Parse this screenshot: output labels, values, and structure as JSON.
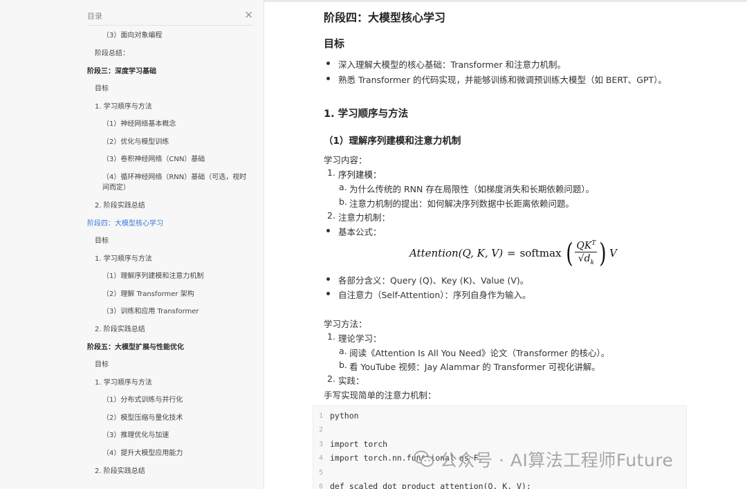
{
  "toc": {
    "title": "目录",
    "close_icon": "×",
    "items": [
      {
        "label": "（3）面向对象编程"
      },
      {
        "label": "阶段总结："
      },
      {
        "label": "阶段三：深度学习基础"
      },
      {
        "label": "目标"
      },
      {
        "label": "1. 学习顺序与方法"
      },
      {
        "label": "（1）神经网络基本概念"
      },
      {
        "label": "（2）优化与模型训练"
      },
      {
        "label": "（3）卷积神经网络（CNN）基础"
      },
      {
        "label": "（4）循环神经网络（RNN）基础（可选，视时间而定）"
      },
      {
        "label": "2. 阶段实践总结"
      },
      {
        "label": "阶段四：大模型核心学习",
        "active": true
      },
      {
        "label": "目标"
      },
      {
        "label": "1. 学习顺序与方法"
      },
      {
        "label": "（1）理解序列建模和注意力机制"
      },
      {
        "label": "（2）理解 Transformer 架构"
      },
      {
        "label": "（3）训练和应用 Transformer"
      },
      {
        "label": "2. 阶段实践总结"
      },
      {
        "label": "阶段五：大模型扩展与性能优化"
      },
      {
        "label": "目标"
      },
      {
        "label": "1. 学习顺序与方法"
      },
      {
        "label": "（1）分布式训练与并行化"
      },
      {
        "label": "（2）模型压缩与量化技术"
      },
      {
        "label": "（3）推理优化与加速"
      },
      {
        "label": "（4）提升大模型应用能力"
      },
      {
        "label": "2. 阶段实践总结"
      }
    ]
  },
  "article": {
    "stage_title": "阶段四：大模型核心学习",
    "goal_heading": "目标",
    "goals": [
      "深入理解大模型的核心基础：Transformer 和注意力机制。",
      "熟悉 Transformer 的代码实现，并能够训练和微调预训练大模型（如 BERT、GPT）。"
    ],
    "section_heading": "1. 学习顺序与方法",
    "sub_heading": "（1）理解序列建模和注意力机制",
    "content_label": "学习内容：",
    "content": {
      "n1": "1.",
      "item1": "序列建模：",
      "a_label": "a.",
      "item1a": "为什么传统的 RNN 存在局限性（如梯度消失和长期依赖问题）。",
      "b_label": "b.",
      "item1b": "注意力机制的提出：如何解决序列数据中长距离依赖问题。",
      "n2": "2.",
      "item2": "注意力机制：",
      "formula_bullet": "基本公式：",
      "meaning_label": "各部分含义：",
      "meaning_text": "Query (Q)、Key (K)、Value (V)。",
      "self_attn_label": "自注意力（Self-Attention）：",
      "self_attn_text": "序列自身作为输入。"
    },
    "formula": {
      "lhs": "Attention(Q, K, V)",
      "eq": "=",
      "fn": "softmax",
      "num": "QK",
      "num_sup": "T",
      "den": "√d",
      "den_sub": "k",
      "rhs": "V"
    },
    "method_label": "学习方法：",
    "method": {
      "n1": "1.",
      "item1": "理论学习：",
      "a_label": "a.",
      "item1a": "阅读《Attention Is All You Need》论文（Transformer 的核心）。",
      "b_label": "b.",
      "item1b": "看 YouTube 视频：Jay Alammar 的 Transformer 可视化讲解。",
      "n2": "2.",
      "item2": "实践：",
      "handwrite": "手写实现简单的注意力机制："
    },
    "code": {
      "lines": [
        {
          "n": "1",
          "text": "python"
        },
        {
          "n": "2",
          "text": ""
        },
        {
          "n": "3",
          "text": "import torch"
        },
        {
          "n": "4",
          "text": "import torch.nn.functional as F"
        },
        {
          "n": "5",
          "text": ""
        },
        {
          "n": "6",
          "text": "def scaled_dot_product_attention(Q, K, V):"
        }
      ]
    }
  },
  "watermark": {
    "text": "公众号 · AI算法工程师Future",
    "icon": "wechat-icon"
  }
}
